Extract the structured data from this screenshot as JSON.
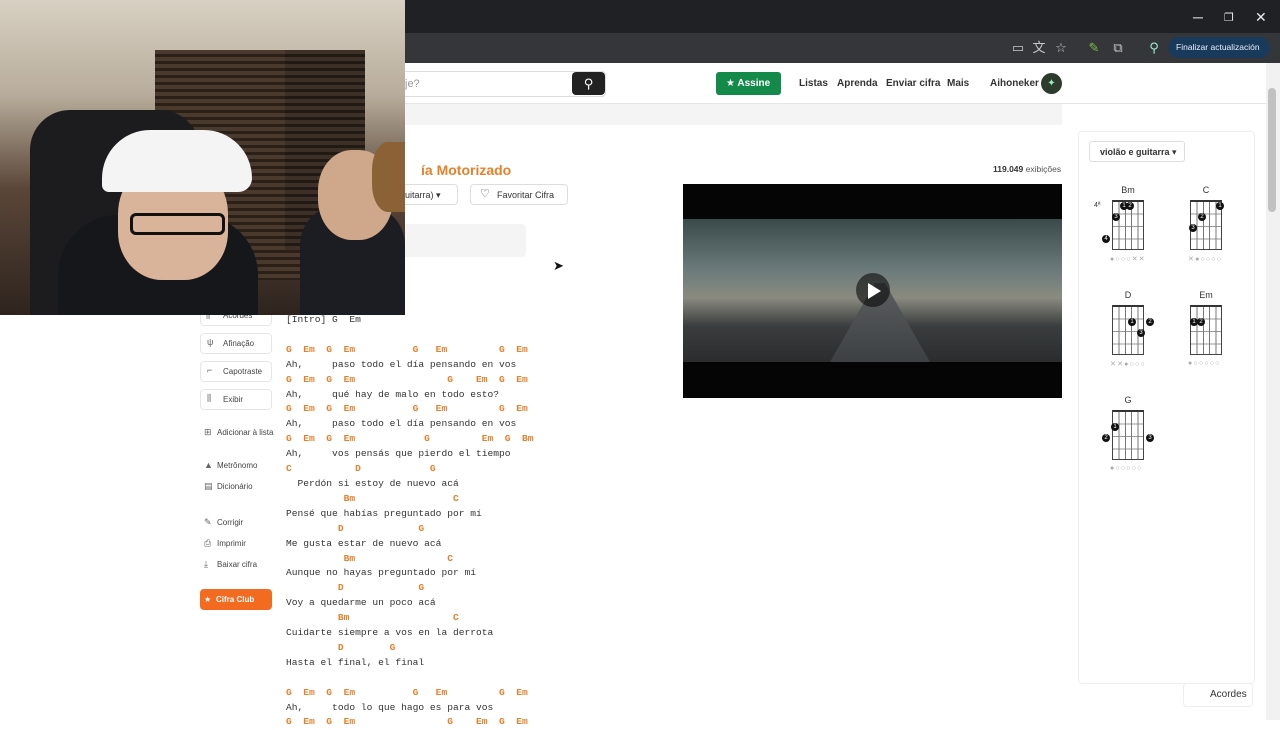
{
  "browser": {
    "update_label": "Finalizar actualización",
    "window_controls": {
      "minimize": "─",
      "restore": "❐",
      "close": "✕"
    }
  },
  "header": {
    "search_placeholder": "je?",
    "assine_label": "Assine",
    "nav": [
      "Listas",
      "Aprenda",
      "Enviar cifra",
      "Mais"
    ],
    "username": "Aihoneker"
  },
  "song": {
    "title": "ía Motorizado",
    "views_count": "119.049",
    "views_label": "exibições",
    "tuning_label": "uitarra)",
    "favorite_label": "Favoritar Cifra"
  },
  "instrument_select": "violão e guitarra",
  "chords": [
    {
      "name": "Bm",
      "fret_label": "4ª",
      "strings": "●○○○✕✕"
    },
    {
      "name": "C",
      "fret_label": "",
      "strings": "✕●○○○○"
    },
    {
      "name": "D",
      "fret_label": "",
      "strings": "✕✕●○○○"
    },
    {
      "name": "Em",
      "fret_label": "",
      "strings": "●○○○○○"
    },
    {
      "name": "G",
      "fret_label": "",
      "strings": "●○○○○○"
    }
  ],
  "acordes_tab": "Acordes",
  "left_menu": {
    "acordes": "Acordes",
    "afinacao": "Afinação",
    "capotraste": "Capotraste",
    "exibir": "Exibir",
    "adicionar": "Adicionar à lista",
    "metronomo": "Metrônomo",
    "dicionario": "Dicionário",
    "corrigir": "Corrigir",
    "imprimir": "Imprimir",
    "baixar": "Baixar cifra",
    "pro": "Cifra Club PRO"
  },
  "lyrics": [
    {
      "type": "text",
      "text": "[Intro] G  Em"
    },
    {
      "type": "blank",
      "text": ""
    },
    {
      "type": "chord",
      "text": "G  Em  G  Em          G   Em         G  Em"
    },
    {
      "type": "text",
      "text": "Ah,     paso todo el día pensando en vos"
    },
    {
      "type": "chord",
      "text": "G  Em  G  Em                G    Em  G  Em"
    },
    {
      "type": "text",
      "text": "Ah,     qué hay de malo en todo esto?"
    },
    {
      "type": "chord",
      "text": "G  Em  G  Em          G   Em         G  Em"
    },
    {
      "type": "text",
      "text": "Ah,     paso todo el día pensando en vos"
    },
    {
      "type": "chord",
      "text": "G  Em  G  Em            G         Em  G  Bm"
    },
    {
      "type": "text",
      "text": "Ah,     vos pensás que pierdo el tiempo"
    },
    {
      "type": "chord",
      "text": "C           D            G"
    },
    {
      "type": "text",
      "text": "  Perdón si estoy de nuevo acá"
    },
    {
      "type": "chord",
      "text": "          Bm                 C"
    },
    {
      "type": "text",
      "text": "Pensé que habías preguntado por mí"
    },
    {
      "type": "chord",
      "text": "         D             G"
    },
    {
      "type": "text",
      "text": "Me gusta estar de nuevo acá"
    },
    {
      "type": "chord",
      "text": "          Bm                C"
    },
    {
      "type": "text",
      "text": "Aunque no hayas preguntado por mí"
    },
    {
      "type": "chord",
      "text": "         D             G"
    },
    {
      "type": "text",
      "text": "Voy a quedarme un poco acá"
    },
    {
      "type": "chord",
      "text": "         Bm                  C"
    },
    {
      "type": "text",
      "text": "Cuidarte siempre a vos en la derrota"
    },
    {
      "type": "chord",
      "text": "         D        G"
    },
    {
      "type": "text",
      "text": "Hasta el final, el final"
    },
    {
      "type": "blank",
      "text": ""
    },
    {
      "type": "chord",
      "text": "G  Em  G  Em          G   Em         G  Em"
    },
    {
      "type": "text",
      "text": "Ah,     todo lo que hago es para vos"
    },
    {
      "type": "chord",
      "text": "G  Em  G  Em                G    Em  G  Em"
    }
  ],
  "colors": {
    "accent": "#e8802a",
    "assine_green": "#138a4a",
    "pro_orange": "#f26b21"
  }
}
